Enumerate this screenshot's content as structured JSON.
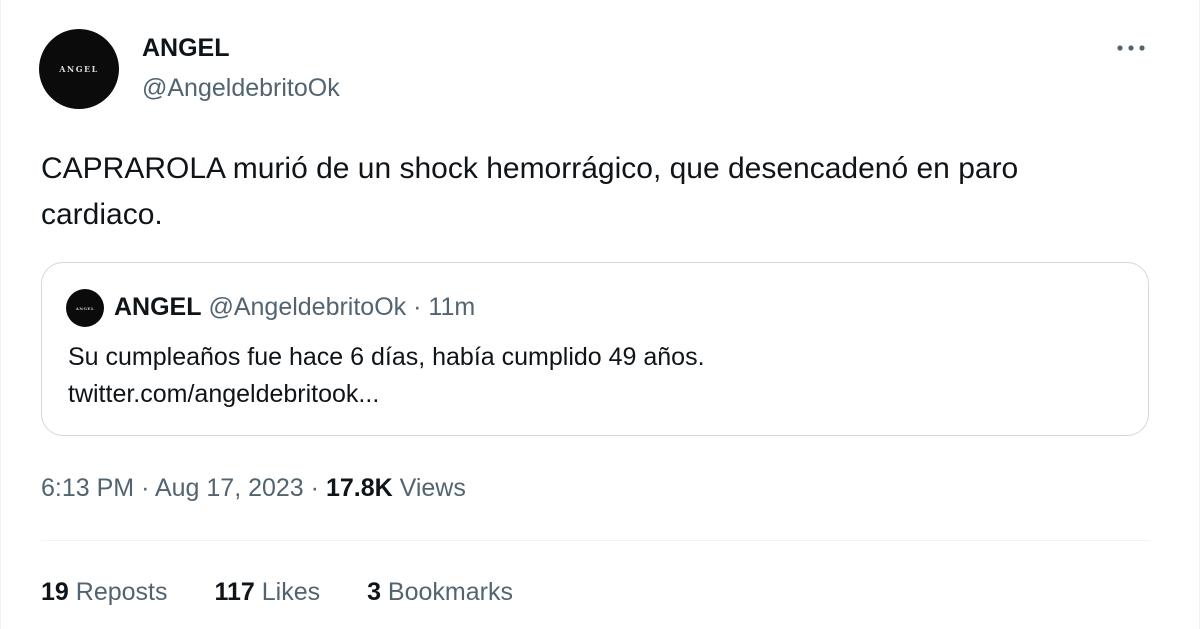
{
  "author": {
    "display_name": "ANGEL",
    "handle": "@AngeldebritoOk",
    "avatar_text": "ANGEL"
  },
  "tweet": {
    "text_line1": "CAPRAROLA murió de un shock hemorrágico, que desencadenó en paro",
    "text_line2": "cardiaco."
  },
  "quote": {
    "display_name": "ANGEL",
    "handle": "@AngeldebritoOk",
    "separator": "·",
    "time": "11m",
    "text_line1": "Su cumpleaños fue hace 6 días, había cumplido 49 años.",
    "text_line2": "twitter.com/angeldebritook..."
  },
  "meta": {
    "time": "6:13 PM",
    "separator": "·",
    "date": "Aug 17, 2023",
    "views_count": "17.8K",
    "views_label": "Views"
  },
  "stats": {
    "reposts_count": "19",
    "reposts_label": "Reposts",
    "likes_count": "117",
    "likes_label": "Likes",
    "bookmarks_count": "3",
    "bookmarks_label": "Bookmarks"
  },
  "icons": {
    "more": "more-horizontal-icon"
  },
  "colors": {
    "text_primary": "#0f1419",
    "text_secondary": "#536471",
    "border": "#cfd9de"
  }
}
